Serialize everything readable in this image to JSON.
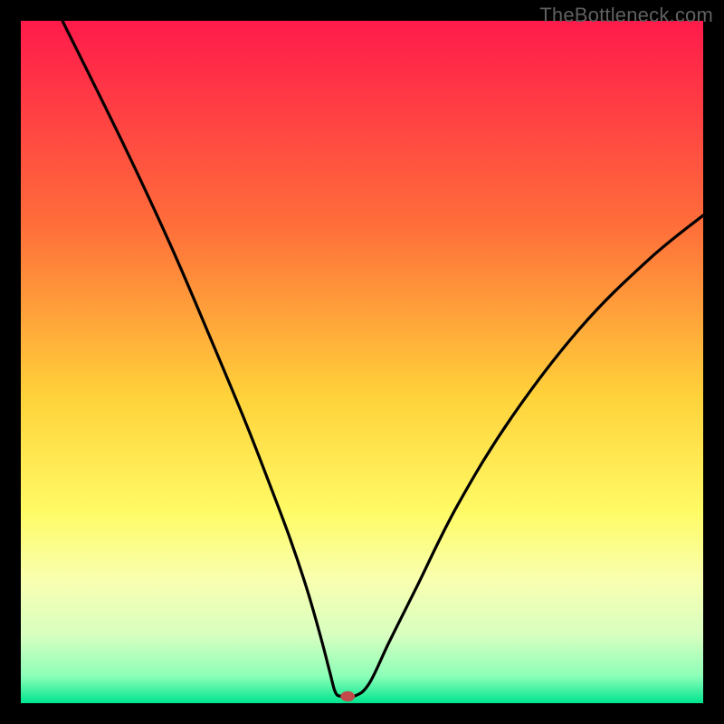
{
  "watermark": "TheBottleneck.com",
  "chart_data": {
    "type": "line",
    "title": "",
    "xlabel": "",
    "ylabel": "",
    "xlim": [
      0,
      100
    ],
    "ylim": [
      0,
      100
    ],
    "background_gradient": {
      "stops": [
        {
          "offset": 0.0,
          "color": "#ff1a4b"
        },
        {
          "offset": 0.3,
          "color": "#ff6e3a"
        },
        {
          "offset": 0.55,
          "color": "#ffd23a"
        },
        {
          "offset": 0.72,
          "color": "#fffb66"
        },
        {
          "offset": 0.82,
          "color": "#f8ffb0"
        },
        {
          "offset": 0.9,
          "color": "#d8ffc0"
        },
        {
          "offset": 0.96,
          "color": "#8dffb8"
        },
        {
          "offset": 1.0,
          "color": "#00e58f"
        }
      ]
    },
    "series": [
      {
        "name": "curve",
        "x": [
          6.1,
          15.0,
          22.0,
          28.0,
          33.0,
          36.5,
          39.5,
          42.0,
          44.0,
          45.3,
          46.1,
          47.0,
          48.8,
          51.0,
          54.0,
          58.0,
          64.0,
          72.0,
          82.0,
          92.0,
          100.0
        ],
        "y": [
          100.0,
          82.0,
          67.0,
          53.0,
          41.0,
          32.0,
          24.0,
          16.5,
          9.5,
          4.5,
          1.6,
          1.0,
          1.0,
          2.8,
          9.0,
          17.0,
          29.0,
          42.0,
          55.0,
          65.0,
          71.5
        ]
      }
    ],
    "marker": {
      "name": "minimum-marker",
      "x": 47.9,
      "y": 1.0,
      "rx_pct": 1.05,
      "ry_pct": 0.75,
      "color": "#c24a4a"
    }
  }
}
